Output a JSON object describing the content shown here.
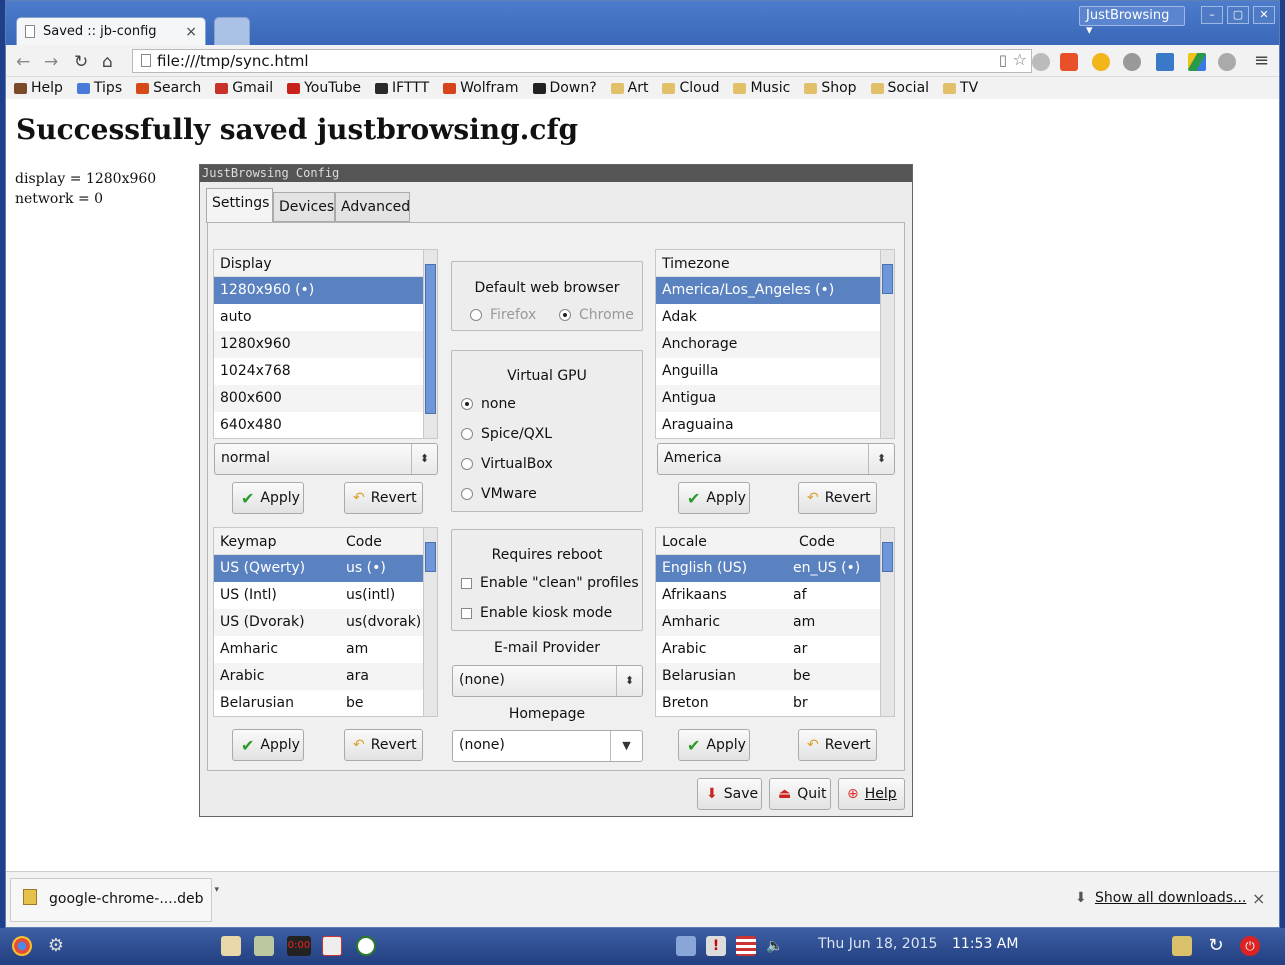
{
  "browser": {
    "tab_title": "Saved :: jb-config",
    "tab_close": "×",
    "user_button": "JustBrowsing ▾",
    "url": "file:///tmp/sync.html",
    "bookmarks": [
      {
        "label": "Help",
        "color": "#7a4a2a"
      },
      {
        "label": "Tips",
        "color": "#4a7ad8"
      },
      {
        "label": "Search",
        "color": "#d64a1a"
      },
      {
        "label": "Gmail",
        "color": "#c8302a"
      },
      {
        "label": "YouTube",
        "color": "#c8201a"
      },
      {
        "label": "IFTTT",
        "color": "#2a2a2a"
      },
      {
        "label": "Wolfram",
        "color": "#d8441a"
      },
      {
        "label": "Down?",
        "color": "#222222"
      },
      {
        "label": "Art",
        "color": "#e2c06a"
      },
      {
        "label": "Cloud",
        "color": "#e2c06a"
      },
      {
        "label": "Music",
        "color": "#e2c06a"
      },
      {
        "label": "Shop",
        "color": "#e2c06a"
      },
      {
        "label": "Social",
        "color": "#e2c06a"
      },
      {
        "label": "TV",
        "color": "#e2c06a"
      }
    ]
  },
  "page": {
    "heading": "Successfully saved justbrowsing.cfg",
    "display_line": "display = 1280x960",
    "network_line": "network = 0"
  },
  "dialog": {
    "title": "JustBrowsing Config",
    "tabs": [
      "Settings",
      "Devices",
      "Advanced"
    ],
    "display": {
      "header": "Display",
      "rows": [
        "1280x960 (•)",
        "auto",
        "1280x960",
        "1024x768",
        "800x600",
        "640x480"
      ],
      "combo": "normal"
    },
    "browser_group": {
      "title": "Default web browser",
      "options": [
        "Firefox",
        "Chrome"
      ],
      "selected": "Chrome"
    },
    "gpu_group": {
      "title": "Virtual GPU",
      "options": [
        "none",
        "Spice/QXL",
        "VirtualBox",
        "VMware"
      ],
      "selected": "none"
    },
    "timezone": {
      "header": "Timezone",
      "rows": [
        "America/Los_Angeles (•)",
        "Adak",
        "Anchorage",
        "Anguilla",
        "Antigua",
        "Araguaina"
      ],
      "combo": "America"
    },
    "keymap": {
      "headers": [
        "Keymap",
        "Code"
      ],
      "rows": [
        [
          "US (Qwerty)",
          "us (•)"
        ],
        [
          "US (Intl)",
          "us(intl)"
        ],
        [
          "US (Dvorak)",
          "us(dvorak)"
        ],
        [
          "Amharic",
          "am"
        ],
        [
          "Arabic",
          "ara"
        ],
        [
          "Belarusian",
          "be"
        ]
      ]
    },
    "reboot_group": {
      "title": "Requires reboot",
      "checks": [
        "Enable \"clean\" profiles",
        "Enable kiosk mode"
      ]
    },
    "email": {
      "label": "E-mail Provider",
      "value": "(none)"
    },
    "homepage": {
      "label": "Homepage",
      "value": "(none)"
    },
    "locale": {
      "headers": [
        "Locale",
        "Code"
      ],
      "rows": [
        [
          "English (US)",
          "en_US (•)"
        ],
        [
          "Afrikaans",
          "af"
        ],
        [
          "Amharic",
          "am"
        ],
        [
          "Arabic",
          "ar"
        ],
        [
          "Belarusian",
          "be"
        ],
        [
          "Breton",
          "br"
        ]
      ]
    },
    "apply": "Apply",
    "revert": "Revert",
    "save": "Save",
    "quit": "Quit",
    "help": "Help"
  },
  "downloads": {
    "item": "google-chrome-....deb",
    "show_all": "Show all downloads...",
    "close": "×"
  },
  "taskbar": {
    "date": "Thu Jun 18, 2015",
    "time": "11:53 AM",
    "clock_icon_text": "0:00"
  }
}
